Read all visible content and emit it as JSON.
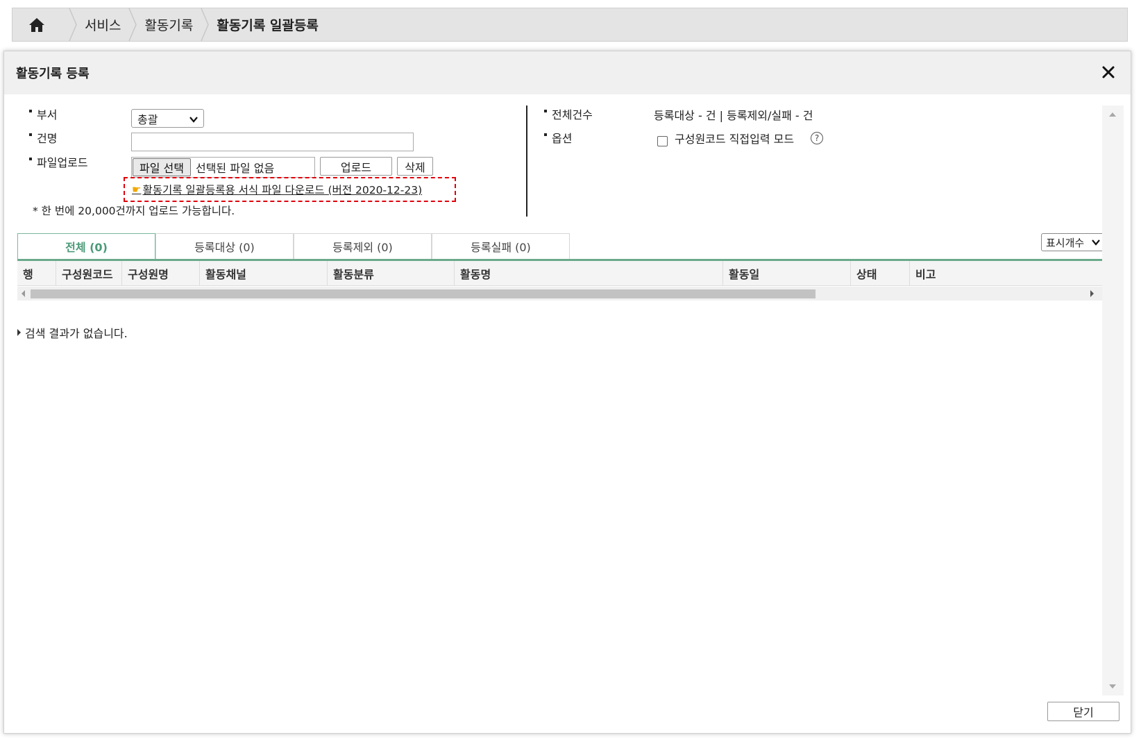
{
  "breadcrumb": {
    "items": [
      {
        "label": "서비스"
      },
      {
        "label": "활동기록"
      },
      {
        "label": "활동기록 일괄등록"
      }
    ]
  },
  "dialog": {
    "title": "활동기록 등록"
  },
  "form": {
    "dept_label": "부서",
    "dept_value": "총괄",
    "name_label": "건명",
    "name_value": "",
    "upload_label": "파일업로드",
    "file_button": "파일 선택",
    "file_status": "선택된 파일 없음",
    "upload_button": "업로드",
    "delete_button": "삭제",
    "download_link": "활동기록 일괄등록용 서식 파일 다운로드 (버전 2020-12-23)",
    "note": "* 한 번에 20,000건까지 업로드 가능합니다."
  },
  "summary": {
    "total_label": "전체건수",
    "total_value": "등록대상 - 건 | 등록제외/실패 - 건",
    "option_label": "옵션",
    "option_checkbox_label": "구성원코드 직접입력 모드",
    "option_checked": false,
    "help_symbol": "?"
  },
  "tabs": [
    {
      "label": "전체 (0)",
      "active": true
    },
    {
      "label": "등록대상 (0)",
      "active": false
    },
    {
      "label": "등록제외 (0)",
      "active": false
    },
    {
      "label": "등록실패 (0)",
      "active": false
    }
  ],
  "display_count_label": "표시개수",
  "grid": {
    "columns": [
      "행",
      "구성원코드",
      "구성원명",
      "활동채널",
      "활동분류",
      "활동명",
      "활동일",
      "상태",
      "비고"
    ],
    "empty_message": "검색 결과가 없습니다."
  },
  "footer": {
    "close_button": "닫기"
  },
  "colors": {
    "accent": "#4a9a78",
    "highlight_border": "#e0000a"
  }
}
